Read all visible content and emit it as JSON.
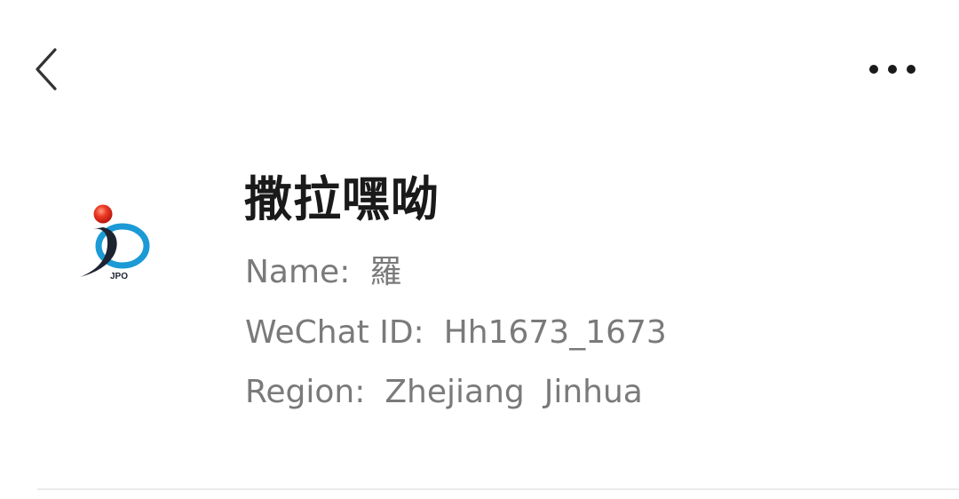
{
  "header": {
    "back_icon": "chevron-left-icon",
    "more_icon": "more-horizontal-icon"
  },
  "profile": {
    "avatar_icon": "jpo-logo",
    "avatar_text": "JPO",
    "nickname": "撒拉嘿呦",
    "name_label": "Name:",
    "name_value": "羅",
    "wechat_label": "WeChat ID:",
    "wechat_value": "Hh1673_1673",
    "region_label": "Region:",
    "region_province": "Zhejiang",
    "region_city": "Jinhua"
  },
  "colors": {
    "background": "#ffffff",
    "nickname": "#1a1a1a",
    "secondary_text": "#7a7a7a",
    "logo_red": "#e8231c",
    "logo_blue": "#1b9ad6",
    "logo_dark": "#1d2330"
  }
}
